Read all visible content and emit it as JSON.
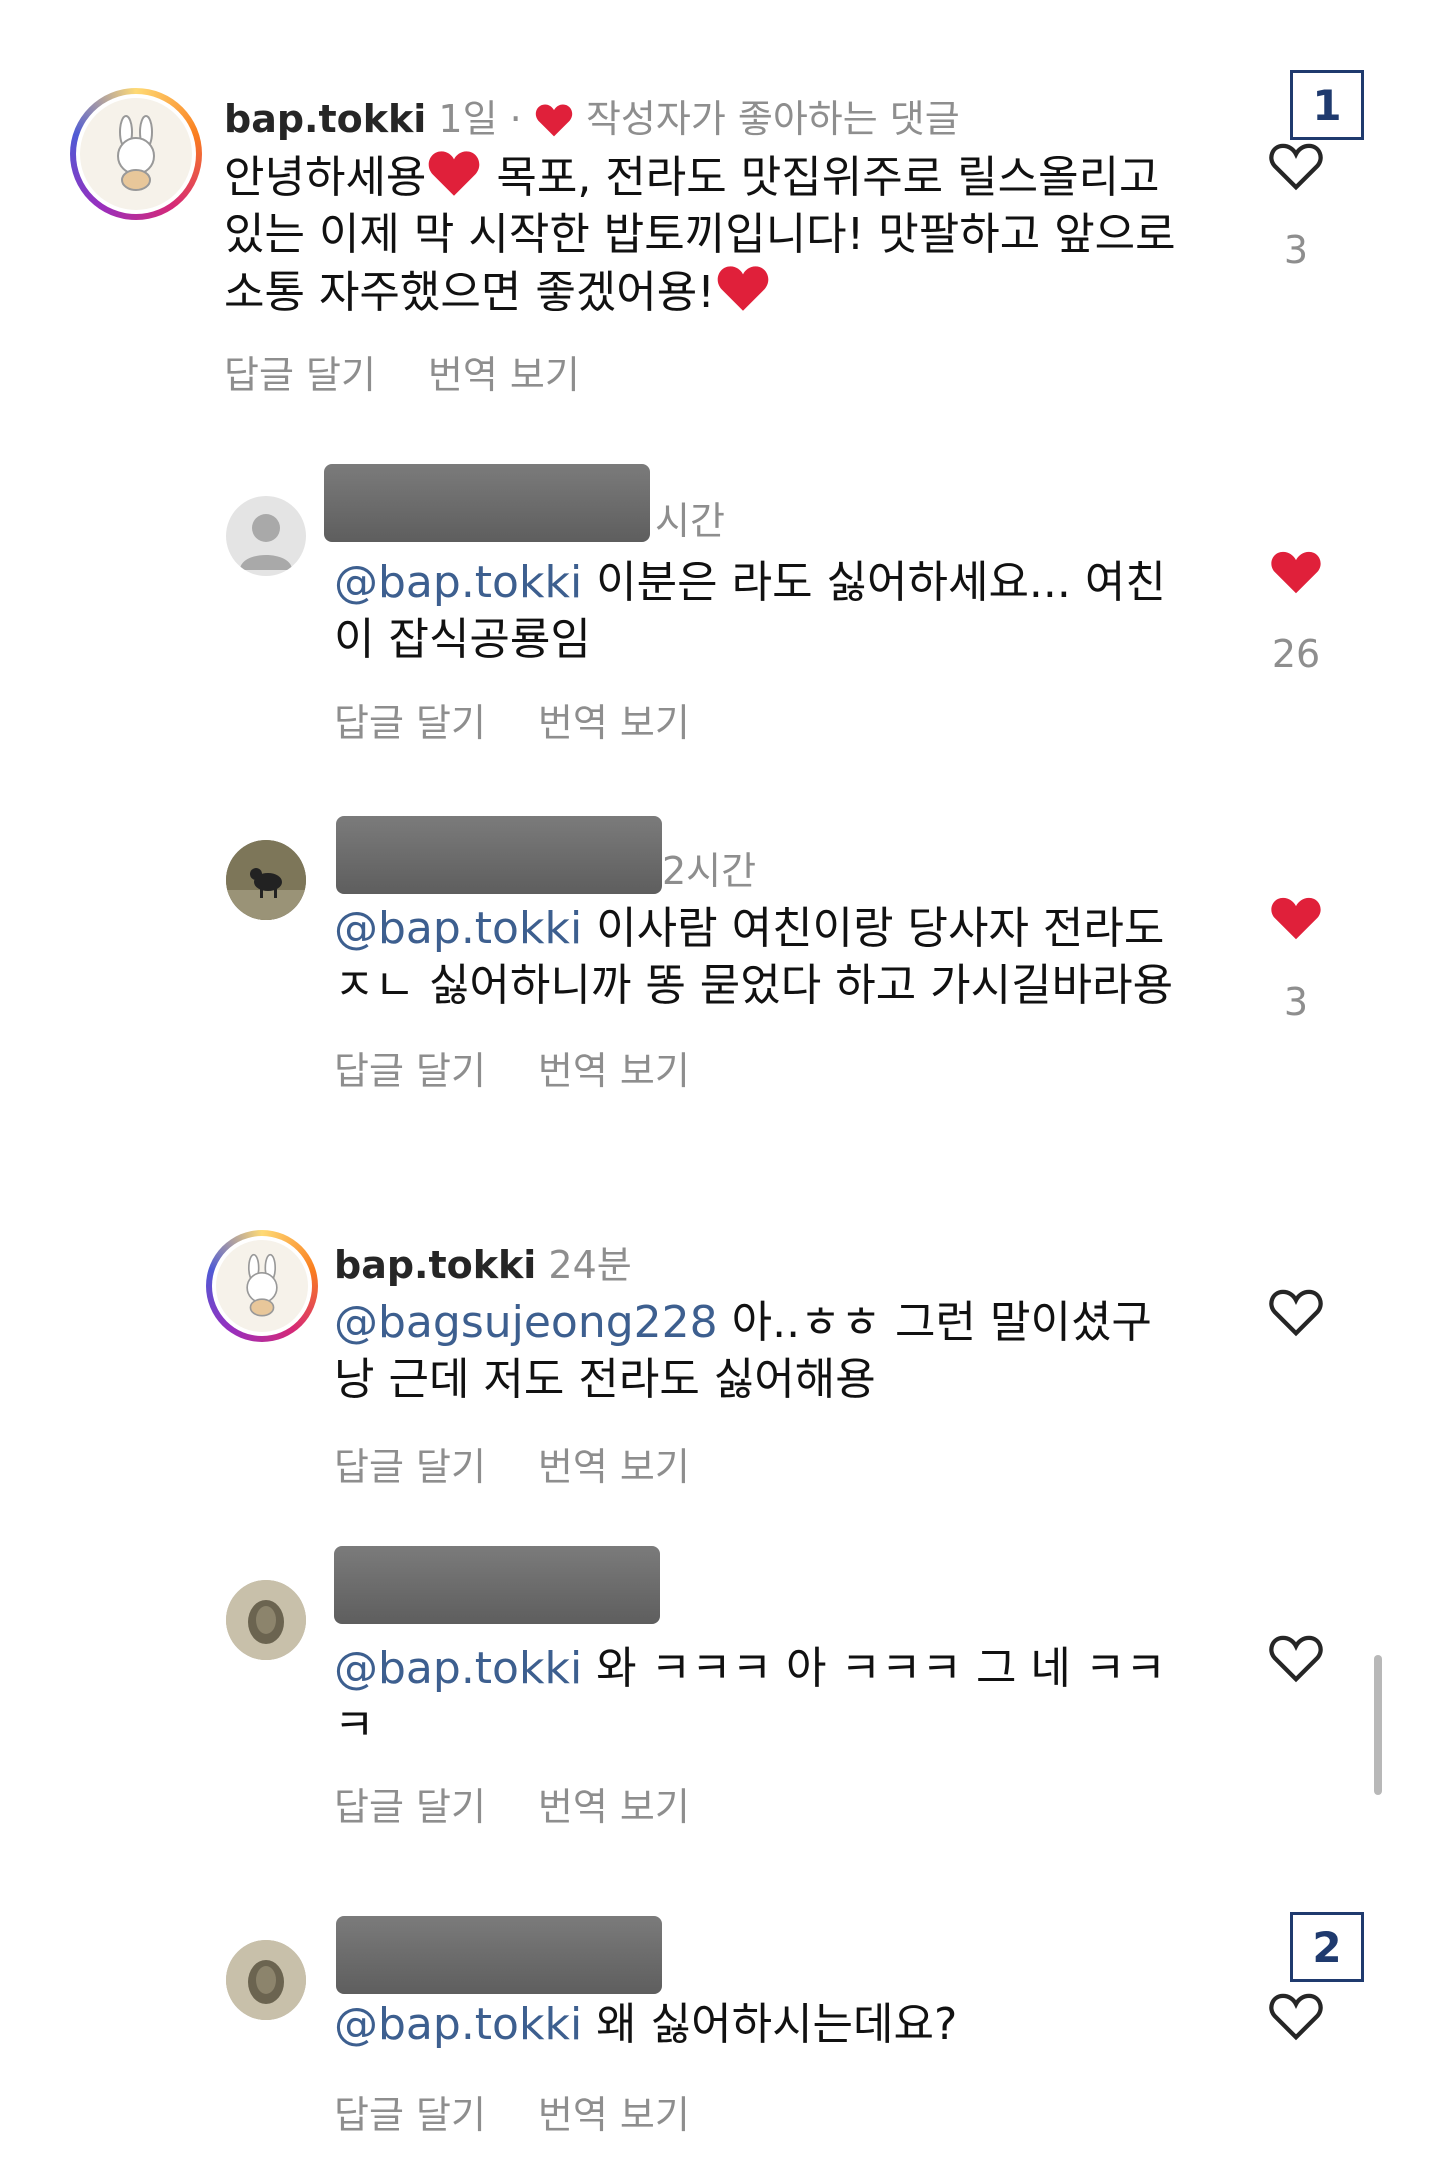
{
  "comments": [
    {
      "username": "bap.tokki",
      "time": "1일",
      "sep": "·",
      "creator_like_label": "작성자가 좋아하는 댓글",
      "text1": "안녕하세용",
      "text2": " 목포, 전라도 맛집위주로 릴스올리고",
      "text3": "있는 이제 막 시작한 밥토끼입니다! 맛팔하고 앞으로",
      "text4": "소통 자주했으면 좋겠어용!",
      "reply_label": "답글 달기",
      "translate_label": "번역 보기",
      "like_count": "3",
      "liked": false
    },
    {
      "time": "시간",
      "mention": "@bap.tokki",
      "text1": " 이분은 라도 싫어하세요... 여친",
      "text2": "이 잡식공룡임",
      "reply_label": "답글 달기",
      "translate_label": "번역 보기",
      "like_count": "26",
      "liked": true
    },
    {
      "time": "2시간",
      "mention": "@bap.tokki",
      "text1": " 이사람 여친이랑 당사자 전라도",
      "text2": "ㅈㄴ 싫어하니까 똥 묻었다 하고 가시길바라용",
      "reply_label": "답글 달기",
      "translate_label": "번역 보기",
      "like_count": "3",
      "liked": true
    },
    {
      "username": "bap.tokki",
      "time": "24분",
      "mention": "@bagsujeong228",
      "text1": " 아..ㅎㅎ 그런 말이셨구",
      "text2": "낭 근데 저도 전라도 싫어해용",
      "reply_label": "답글 달기",
      "translate_label": "번역 보기",
      "liked": false
    },
    {
      "mention": "@bap.tokki",
      "text1": " 와 ㅋㅋㅋ 아 ㅋㅋㅋ 그 네 ㅋㅋ",
      "text2": "ㅋ",
      "reply_label": "답글 달기",
      "translate_label": "번역 보기",
      "liked": false
    },
    {
      "mention": "@bap.tokki",
      "text1": " 왜 싫어하시는데요?",
      "reply_label": "답글 달기",
      "translate_label": "번역 보기",
      "liked": false
    }
  ],
  "markers": [
    "1",
    "2"
  ],
  "colors": {
    "mention": "#3d5f8f",
    "like_red": "#e0203a",
    "muted": "#8e8e8e"
  }
}
